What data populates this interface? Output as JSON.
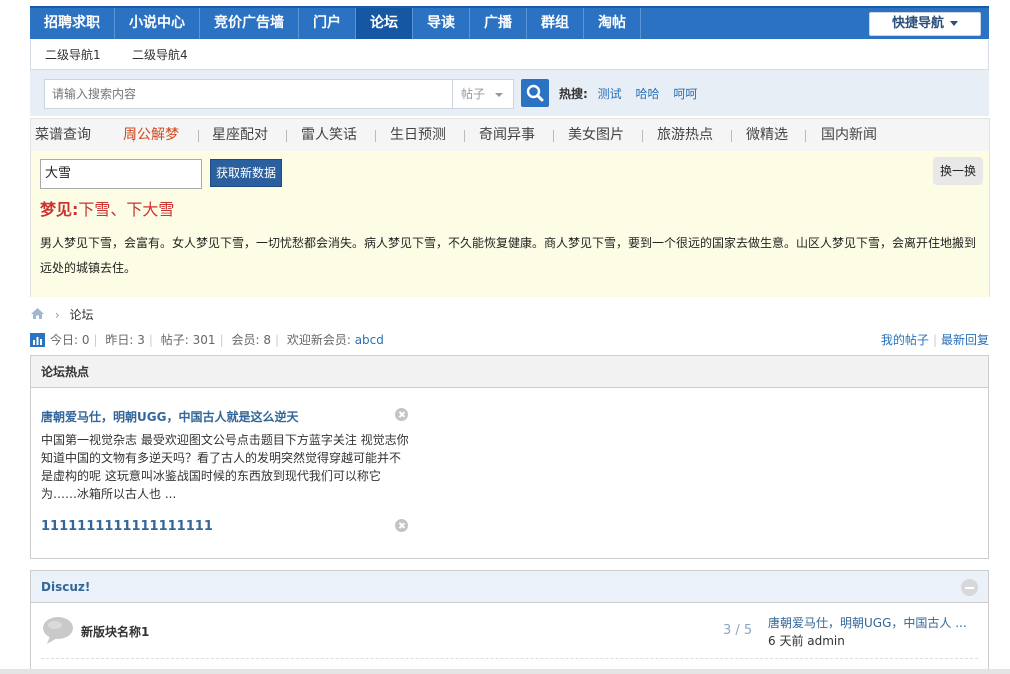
{
  "topnav": {
    "items": [
      "招聘求职",
      "小说中心",
      "竞价广告墙",
      "门户",
      "论坛",
      "导读",
      "广播",
      "群组",
      "淘帖"
    ],
    "active_index": 4,
    "quick_nav": "快捷导航"
  },
  "subnav": {
    "items": [
      "二级导航1",
      "二级导航4"
    ]
  },
  "search": {
    "placeholder": "请输入搜索内容",
    "type": "帖子",
    "hot_label": "热搜:",
    "hot_links": [
      "测试",
      "哈哈",
      "呵呵"
    ]
  },
  "widget": {
    "tabs": [
      "菜谱查询",
      "周公解梦",
      "星座配对",
      "雷人笑话",
      "生日预测",
      "奇闻异事",
      "美女图片",
      "旅游热点",
      "微精选",
      "国内新闻"
    ],
    "active_tab": 1,
    "input_value": "大雪",
    "fetch_button": "获取新数据",
    "swap_button": "换一换",
    "result_keyword": "梦见:",
    "result_value": "下雪、下大雪",
    "result_text": "男人梦见下雪，会富有。女人梦见下雪，一切忧愁都会消失。病人梦见下雪，不久能恢复健康。商人梦见下雪，要到一个很远的国家去做生意。山区人梦见下雪，会离开住地搬到远处的城镇去住。"
  },
  "breadcrumb": {
    "current": "论坛"
  },
  "stats": {
    "today_label": "今日:",
    "today": "0",
    "yesterday_label": "昨日:",
    "yesterday": "3",
    "posts_label": "帖子:",
    "posts": "301",
    "members_label": "会员:",
    "members": "8",
    "newest_label": "欢迎新会员:",
    "newest_member": "abcd",
    "my_posts": "我的帖子",
    "latest_reply": "最新回复"
  },
  "hot_panel": {
    "title": "论坛热点",
    "items": [
      {
        "title": "唐朝爱马仕，明朝UGG，中国古人就是这么逆天",
        "desc": "中国第一视觉杂志 最受欢迎图文公号点击题目下方蓝字关注 视觉志你知道中国的文物有多逆天吗？看了古人的发明突然觉得穿越可能并不是虚构的呢 这玩意叫冰鉴战国时候的东西放到现代我们可以称它为……冰箱所以古人也 ..."
      },
      {
        "title": "1111111111111111111"
      }
    ]
  },
  "forum_panel": {
    "title": "Discuz!",
    "forum": {
      "name": "新版块名称1",
      "count": "3 / 5",
      "last_post": "唐朝爱马仕，明朝UGG，中国古人 ...",
      "last_meta": "6 天前 admin"
    }
  },
  "colors": {
    "primary": "#2b72c2",
    "active_tab": "#d04a1e",
    "link": "#336699"
  },
  "icons": [
    "chevron-down-icon",
    "search-icon",
    "home-icon",
    "stats-icon",
    "close-icon",
    "collapse-icon",
    "forum-bubble-icon"
  ]
}
